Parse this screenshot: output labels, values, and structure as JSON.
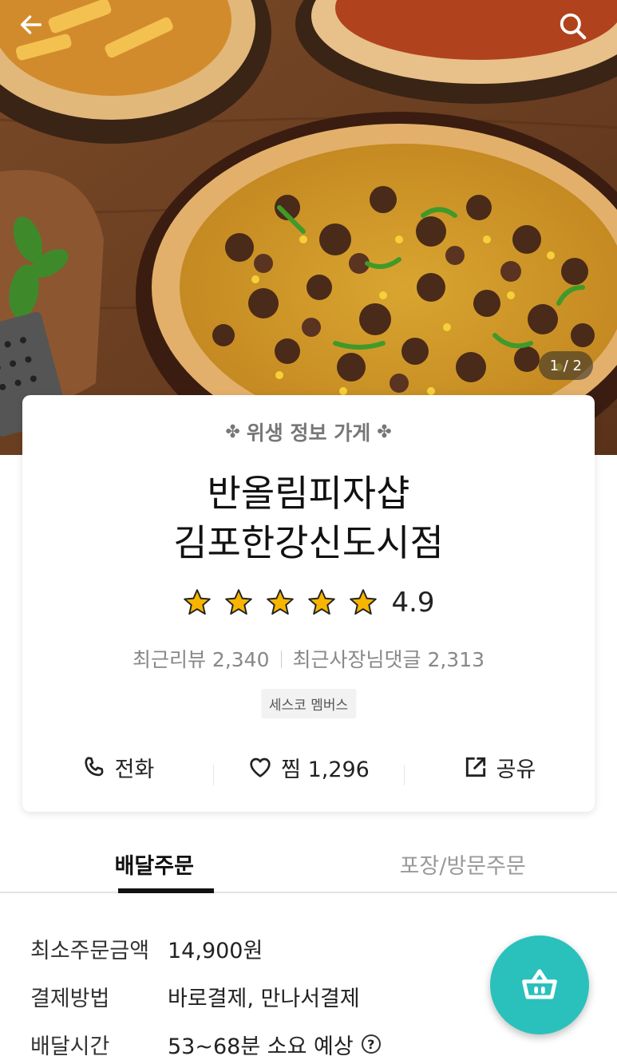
{
  "hero": {
    "page_indicator": "1 / 2",
    "back_icon": "arrow-left-icon",
    "search_icon": "search-icon"
  },
  "store": {
    "hygiene_label": "위생 정보 가게",
    "name_line1": "반올림피자샵",
    "name_line2": "김포한강신도시점",
    "rating": 4.9,
    "rating_text": "4.9",
    "star_count": 5,
    "recent_reviews": "최근리뷰 2,340",
    "recent_owner_replies": "최근사장님댓글 2,313",
    "badge": "세스코 멤버스"
  },
  "actions": {
    "call_label": "전화",
    "favorite_label": "찜 1,296",
    "share_label": "공유"
  },
  "tabs": [
    {
      "label": "배달주문",
      "active": true
    },
    {
      "label": "포장/방문주문",
      "active": false
    }
  ],
  "order_info": [
    {
      "label": "최소주문금액",
      "value": "14,900원"
    },
    {
      "label": "결제방법",
      "value": "바로결제, 만나서결제"
    },
    {
      "label": "배달시간",
      "value": "53~68분 소요 예상"
    }
  ],
  "colors": {
    "accent": "#2ac1bc",
    "star": "#f7b500",
    "text": "#222222"
  },
  "cart_icon": "cart-basket-icon"
}
